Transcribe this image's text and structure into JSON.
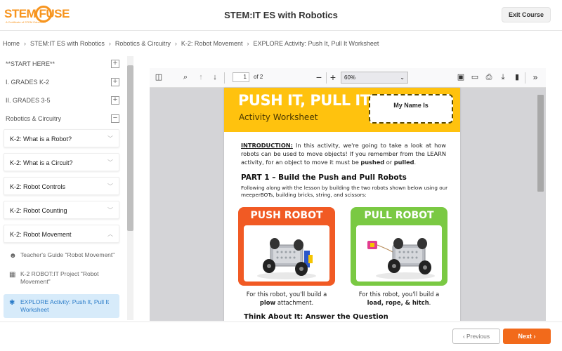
{
  "header": {
    "logo_text": "STEM  FUSE",
    "logo_sub": "A Certificate of STEM Education",
    "title": "STEM:IT ES with Robotics",
    "exit_label": "Exit Course"
  },
  "breadcrumb": [
    "Home",
    "STEM:IT ES with Robotics",
    "Robotics & Circuitry",
    "K-2: Robot Movement",
    "EXPLORE Activity: Push It, Pull It Worksheet"
  ],
  "sidebar": {
    "sections": [
      {
        "label": "**START HERE**",
        "toggle": "+"
      },
      {
        "label": "I. GRADES K-2",
        "toggle": "+"
      },
      {
        "label": "II. GRADES 3-5",
        "toggle": "+"
      },
      {
        "label": "Robotics & Circuitry",
        "toggle": "−"
      }
    ],
    "cards": [
      {
        "label": "K-2: What is a Robot?"
      },
      {
        "label": "K-2: What is a Circuit?"
      },
      {
        "label": "K-2: Robot Controls"
      },
      {
        "label": "K-2: Robot Counting"
      },
      {
        "label": "K-2: Robot Movement"
      }
    ],
    "sub_items": [
      {
        "label": "Teacher's Guide \"Robot Movement\""
      },
      {
        "label": "K-2 ROBOT:IT Project \"Robot Movement\""
      },
      {
        "label": "EXPLORE Activity: Push It, Pull It Worksheet"
      }
    ]
  },
  "viewer": {
    "page_value": "1",
    "page_of": "of 2",
    "zoom": "60%"
  },
  "worksheet": {
    "title": "PUSH IT, PULL IT!",
    "subtitle": "Activity Worksheet",
    "name_label": "My Name Is",
    "intro_label": "INTRODUCTION:",
    "intro_text": " In this activity, we're going to take a look at how robots can be used to move objects! If you remember from the LEARN activity, for an object to move it must be ",
    "intro_pushed": "pushed",
    "intro_or": " or ",
    "intro_pulled": "pulled",
    "intro_end": ".",
    "part1_title": "PART 1 – Build the Push and Pull Robots",
    "part1_desc": "Following along with the lesson by building the two robots shown below using our meeperBOTs, building bricks, string, and scissors:",
    "push_title": "PUSH ROBOT",
    "pull_title": "PULL ROBOT",
    "push_caption_1": "For this robot, you'll build a",
    "push_caption_2": "plow",
    "push_caption_3": " attachment.",
    "pull_caption_1": "For this robot, you'll build a",
    "pull_caption_2": "load, rope, & hitch",
    "pull_caption_3": ".",
    "think_title": "Think About It: Answer the Question"
  },
  "footer": {
    "prev_label": "‹ Previous",
    "next_label": "Next ›"
  },
  "colors": {
    "accent": "#f26a1b",
    "banner": "#ffc20e",
    "push": "#f15a24",
    "pull": "#7ac943",
    "active_bg": "#d7ebfa"
  }
}
